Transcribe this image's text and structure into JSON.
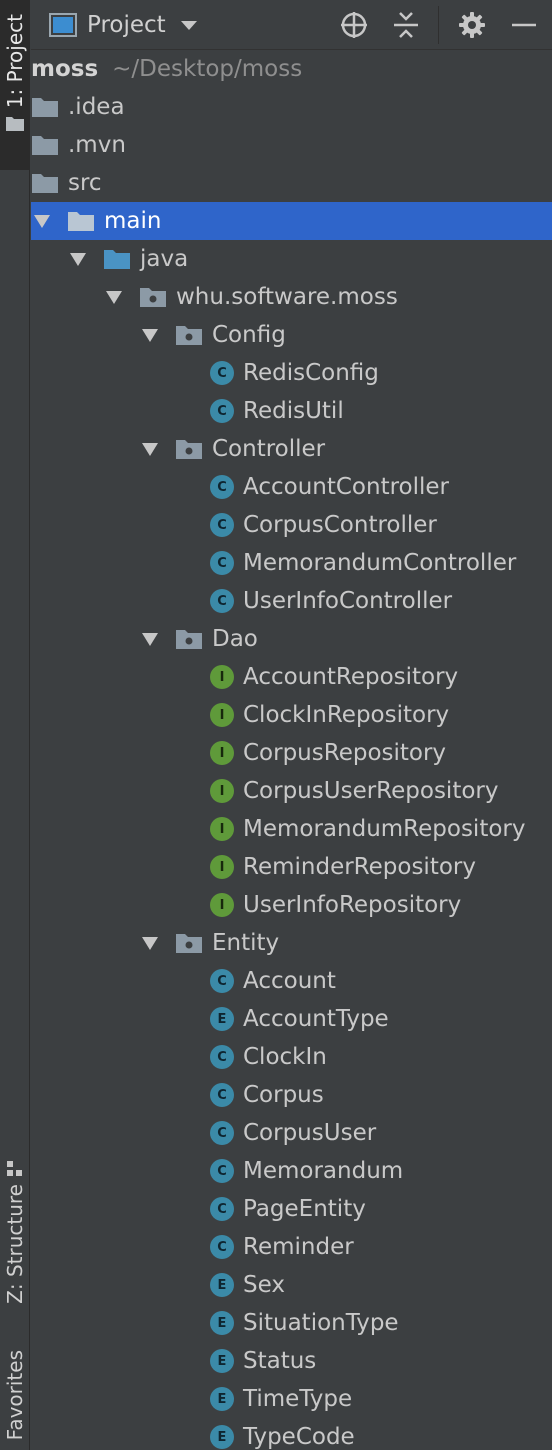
{
  "sidebar": {
    "project_tab": "1: Project",
    "structure_tab": "Z: Structure",
    "favorites_tab": "Favorites"
  },
  "header": {
    "view_label": "Project",
    "icons": [
      "locate-icon",
      "collapse-all-icon",
      "gear-icon",
      "hide-icon"
    ]
  },
  "colors": {
    "selection": "#2f65ca",
    "class_badge": "#3b8aa8",
    "interface_badge": "#5f9a3a",
    "folder_blue": "#4a93c4",
    "folder_grey": "#8c9aa6"
  },
  "tree": {
    "root": {
      "name": "moss",
      "path": "~/Desktop/moss"
    },
    "rows": [
      {
        "label": ".idea",
        "type": "folder-grey",
        "depth": 0
      },
      {
        "label": ".mvn",
        "type": "folder-grey",
        "depth": 0
      },
      {
        "label": "src",
        "type": "folder-grey",
        "depth": 0
      },
      {
        "label": "main",
        "type": "folder-grey",
        "depth": 1,
        "expanded": true,
        "selected": true
      },
      {
        "label": "java",
        "type": "folder-blue",
        "depth": 2,
        "expanded": true
      },
      {
        "label": "whu.software.moss",
        "type": "package",
        "depth": 3,
        "expanded": true
      },
      {
        "label": "Config",
        "type": "package",
        "depth": 4,
        "expanded": true
      },
      {
        "label": "RedisConfig",
        "type": "class",
        "badge": "C",
        "depth": 5
      },
      {
        "label": "RedisUtil",
        "type": "class",
        "badge": "C",
        "depth": 5
      },
      {
        "label": "Controller",
        "type": "package",
        "depth": 4,
        "expanded": true
      },
      {
        "label": "AccountController",
        "type": "class",
        "badge": "C",
        "depth": 5
      },
      {
        "label": "CorpusController",
        "type": "class",
        "badge": "C",
        "depth": 5
      },
      {
        "label": "MemorandumController",
        "type": "class",
        "badge": "C",
        "depth": 5
      },
      {
        "label": "UserInfoController",
        "type": "class",
        "badge": "C",
        "depth": 5
      },
      {
        "label": "Dao",
        "type": "package",
        "depth": 4,
        "expanded": true
      },
      {
        "label": "AccountRepository",
        "type": "interface",
        "badge": "I",
        "depth": 5
      },
      {
        "label": "ClockInRepository",
        "type": "interface",
        "badge": "I",
        "depth": 5
      },
      {
        "label": "CorpusRepository",
        "type": "interface",
        "badge": "I",
        "depth": 5
      },
      {
        "label": "CorpusUserRepository",
        "type": "interface",
        "badge": "I",
        "depth": 5
      },
      {
        "label": "MemorandumRepository",
        "type": "interface",
        "badge": "I",
        "depth": 5
      },
      {
        "label": "ReminderRepository",
        "type": "interface",
        "badge": "I",
        "depth": 5
      },
      {
        "label": "UserInfoRepository",
        "type": "interface",
        "badge": "I",
        "depth": 5
      },
      {
        "label": "Entity",
        "type": "package",
        "depth": 4,
        "expanded": true
      },
      {
        "label": "Account",
        "type": "class",
        "badge": "C",
        "depth": 5
      },
      {
        "label": "AccountType",
        "type": "enum",
        "badge": "E",
        "depth": 5
      },
      {
        "label": "ClockIn",
        "type": "class",
        "badge": "C",
        "depth": 5
      },
      {
        "label": "Corpus",
        "type": "class",
        "badge": "C",
        "depth": 5
      },
      {
        "label": "CorpusUser",
        "type": "class",
        "badge": "C",
        "depth": 5
      },
      {
        "label": "Memorandum",
        "type": "class",
        "badge": "C",
        "depth": 5
      },
      {
        "label": "PageEntity",
        "type": "class",
        "badge": "C",
        "depth": 5
      },
      {
        "label": "Reminder",
        "type": "class",
        "badge": "C",
        "depth": 5
      },
      {
        "label": "Sex",
        "type": "enum",
        "badge": "E",
        "depth": 5
      },
      {
        "label": "SituationType",
        "type": "enum",
        "badge": "E",
        "depth": 5
      },
      {
        "label": "Status",
        "type": "enum",
        "badge": "E",
        "depth": 5
      },
      {
        "label": "TimeType",
        "type": "enum",
        "badge": "E",
        "depth": 5
      },
      {
        "label": "TypeCode",
        "type": "enum",
        "badge": "E",
        "depth": 5
      }
    ]
  }
}
